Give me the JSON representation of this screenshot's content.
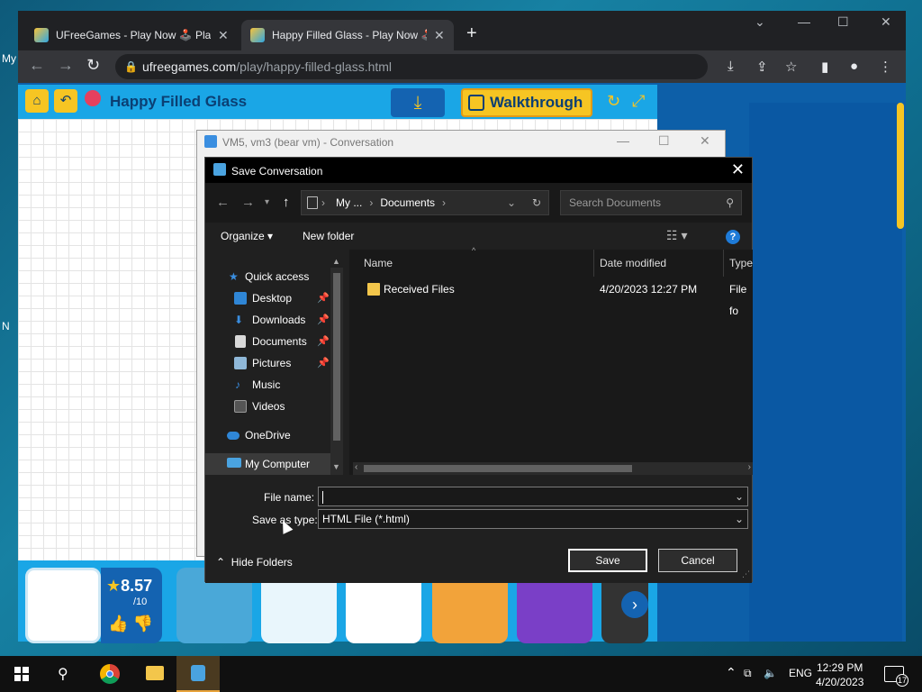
{
  "desktop": {
    "left_labels": [
      "My",
      "N"
    ]
  },
  "browser": {
    "tabs": [
      {
        "label": "UFreeGames - Play Now 🕹️ Play"
      },
      {
        "label": "Happy Filled Glass - Play Now 🕹️"
      }
    ],
    "url_host": "ufreegames.com",
    "url_path": "/play/happy-filled-glass.html"
  },
  "game": {
    "title": "Happy Filled Glass",
    "walkthrough_label": "Walkthrough",
    "rating": {
      "score": "8.57",
      "denominator": "/10"
    }
  },
  "conversation_window": {
    "title": "VM5, vm3 (bear vm) - Conversation"
  },
  "save_dialog": {
    "title": "Save Conversation",
    "breadcrumb": [
      "My ...",
      "Documents"
    ],
    "search_placeholder": "Search Documents",
    "commands": {
      "organize": "Organize",
      "new_folder": "New folder"
    },
    "help_label": "?",
    "nav": {
      "quick_access": "Quick access",
      "items": [
        "Desktop",
        "Downloads",
        "Documents",
        "Pictures",
        "Music",
        "Videos"
      ],
      "onedrive": "OneDrive",
      "my_computer": "My Computer"
    },
    "columns": {
      "name": "Name",
      "date_modified": "Date modified",
      "type": "Type"
    },
    "files": [
      {
        "name": "Received Files",
        "date": "4/20/2023 12:27 PM",
        "type": "File fo"
      }
    ],
    "file_name_label": "File name:",
    "file_name_value": "",
    "save_type_label": "Save as type:",
    "save_type_value": "HTML File (*.html)",
    "hide_folders": "Hide Folders",
    "save_button": "Save",
    "cancel_button": "Cancel"
  },
  "taskbar": {
    "language": "ENG",
    "time": "12:29 PM",
    "date": "4/20/2023",
    "notification_count": "17"
  },
  "colors": {
    "accent": "#1e7bd8",
    "game_blue": "#1aa6e6",
    "game_yellow": "#f6c523"
  }
}
